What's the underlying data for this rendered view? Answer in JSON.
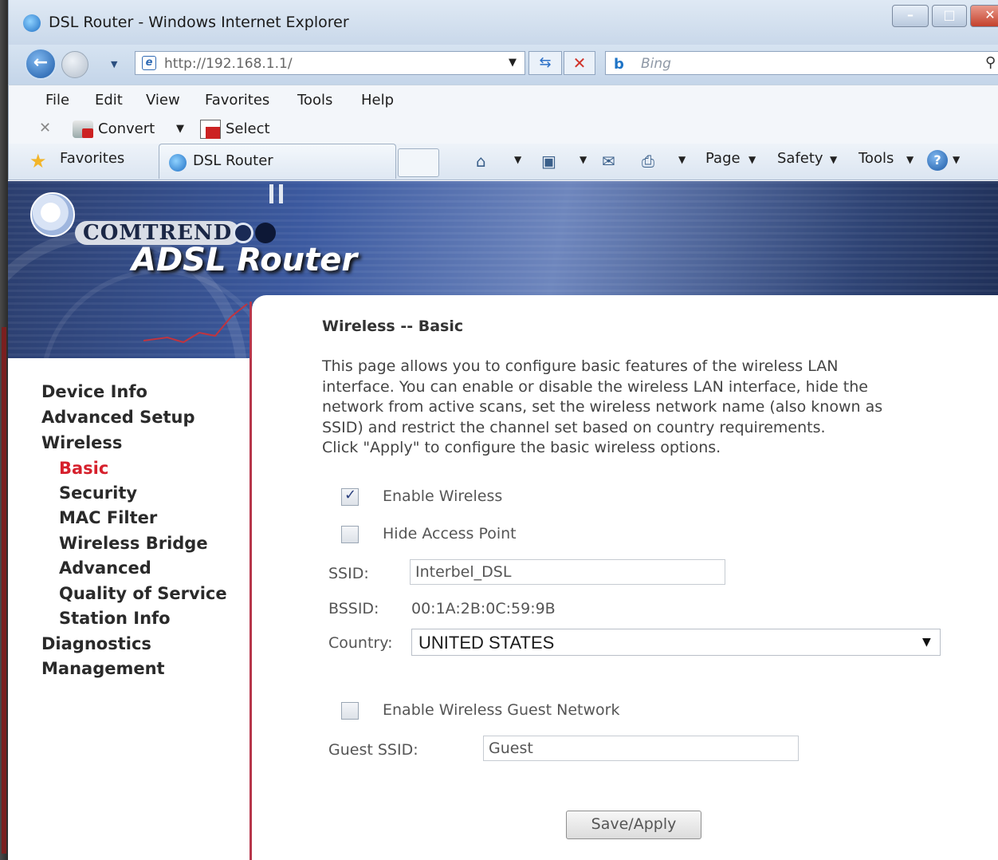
{
  "window": {
    "title": "DSL Router - Windows Internet Explorer"
  },
  "navbar": {
    "address": "http://192.168.1.1/",
    "search_placeholder": "Bing"
  },
  "menu": [
    "File",
    "Edit",
    "View",
    "Favorites",
    "Tools",
    "Help"
  ],
  "command_bar": {
    "convert_label": "Convert",
    "select_label": "Select",
    "favorites_label": "Favorites",
    "tab_label": "DSL Router",
    "page_label": "Page",
    "safety_label": "Safety",
    "tools_label": "Tools"
  },
  "banner": {
    "brand": "COMTREND",
    "title": "ADSL Router"
  },
  "sidebar": {
    "items": [
      {
        "label": "Device Info",
        "level": 1
      },
      {
        "label": "Advanced Setup",
        "level": 1
      },
      {
        "label": "Wireless",
        "level": 1
      },
      {
        "label": "Basic",
        "level": 2,
        "active": true
      },
      {
        "label": "Security",
        "level": 2
      },
      {
        "label": "MAC Filter",
        "level": 2
      },
      {
        "label": "Wireless Bridge",
        "level": 2
      },
      {
        "label": "Advanced",
        "level": 2
      },
      {
        "label": "Quality of Service",
        "level": 2
      },
      {
        "label": "Station Info",
        "level": 2
      },
      {
        "label": "Diagnostics",
        "level": 1
      },
      {
        "label": "Management",
        "level": 1
      }
    ]
  },
  "main": {
    "heading": "Wireless -- Basic",
    "intro": [
      "This page allows you to configure basic features of the wireless LAN",
      "interface. You can enable or disable the wireless LAN interface, hide the",
      "network from active scans, set the wireless network name (also known as",
      "SSID) and restrict the channel set based on country requirements.",
      "Click \"Apply\" to configure the basic wireless options."
    ],
    "enable_wireless": {
      "label": "Enable Wireless",
      "checked": true
    },
    "hide_access_point": {
      "label": "Hide Access Point",
      "checked": false
    },
    "ssid": {
      "label": "SSID:",
      "value": "Interbel_DSL"
    },
    "bssid": {
      "label": "BSSID:",
      "value": "00:1A:2B:0C:59:9B"
    },
    "country": {
      "label": "Country:",
      "value": "UNITED STATES"
    },
    "guest_network": {
      "label": "Enable Wireless Guest Network",
      "checked": false
    },
    "guest_ssid": {
      "label": "Guest SSID:",
      "value": "Guest"
    },
    "save_button": "Save/Apply"
  },
  "colors": {
    "active_nav": "#d6202c",
    "sidebar_border": "#b7364b"
  }
}
